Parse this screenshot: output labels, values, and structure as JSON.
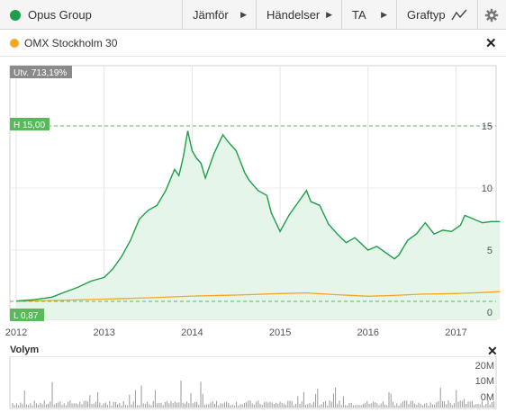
{
  "toolbar": {
    "title": "Opus Group",
    "compare": "Jämför",
    "events": "Händelser",
    "ta": "TA",
    "charttype": "Graftyp"
  },
  "colors": {
    "price_line": "#1e9e4a",
    "price_fill": "#e6f5e9",
    "index_line": "#f5a623",
    "label_bg": "#5cb85c",
    "change_bg": "#8a8a8a"
  },
  "legend": {
    "index_name": "OMX Stockholm 30"
  },
  "labels": {
    "change": "Utv. 713,19%",
    "high": "H 15,00",
    "low": "L 0,87"
  },
  "volume": {
    "title": "Volym",
    "ticks": [
      "20M",
      "10M",
      "0M"
    ]
  },
  "chart_data": {
    "type": "area",
    "x_ticks": [
      "2012",
      "2013",
      "2014",
      "2015",
      "2016",
      "2017"
    ],
    "y_ticks": [
      0,
      5,
      10,
      15
    ],
    "ylim": [
      0,
      15
    ],
    "xlim": [
      2012.0,
      2017.55
    ],
    "high": 15.0,
    "low": 0.87,
    "series": [
      {
        "name": "Opus Group",
        "x": [
          2012.0,
          2012.2,
          2012.4,
          2012.55,
          2012.7,
          2012.85,
          2013.0,
          2013.1,
          2013.2,
          2013.3,
          2013.4,
          2013.5,
          2013.6,
          2013.7,
          2013.8,
          2013.85,
          2013.9,
          2013.95,
          2014.0,
          2014.05,
          2014.1,
          2014.15,
          2014.25,
          2014.35,
          2014.4,
          2014.5,
          2014.6,
          2014.65,
          2014.75,
          2014.85,
          2014.9,
          2015.0,
          2015.1,
          2015.2,
          2015.3,
          2015.35,
          2015.45,
          2015.55,
          2015.65,
          2015.75,
          2015.85,
          2016.0,
          2016.1,
          2016.2,
          2016.3,
          2016.35,
          2016.45,
          2016.55,
          2016.65,
          2016.75,
          2016.85,
          2016.95,
          2017.05,
          2017.1,
          2017.2,
          2017.3,
          2017.4,
          2017.5
        ],
        "values": [
          0.9,
          1.0,
          1.2,
          1.6,
          2.0,
          2.5,
          2.8,
          3.5,
          4.5,
          5.8,
          7.5,
          8.2,
          8.6,
          9.8,
          11.5,
          11.0,
          12.5,
          14.6,
          13.0,
          12.4,
          12.0,
          10.8,
          12.8,
          14.3,
          13.8,
          13.0,
          11.2,
          10.6,
          9.8,
          9.4,
          8.0,
          6.5,
          7.8,
          8.8,
          9.8,
          8.9,
          8.6,
          7.1,
          6.3,
          5.6,
          6.0,
          5.0,
          5.3,
          4.8,
          4.3,
          4.6,
          5.8,
          6.3,
          7.2,
          6.3,
          6.6,
          6.5,
          7.0,
          7.8,
          7.5,
          7.2,
          7.3,
          7.3
        ]
      },
      {
        "name": "OMX Stockholm 30",
        "x": [
          2012.0,
          2012.5,
          2013.0,
          2013.5,
          2014.0,
          2014.5,
          2015.0,
          2015.3,
          2015.6,
          2016.0,
          2016.3,
          2016.6,
          2017.0,
          2017.3,
          2017.5
        ],
        "values": [
          0.87,
          0.95,
          1.05,
          1.15,
          1.3,
          1.38,
          1.5,
          1.55,
          1.42,
          1.28,
          1.35,
          1.45,
          1.5,
          1.58,
          1.65
        ]
      }
    ]
  }
}
